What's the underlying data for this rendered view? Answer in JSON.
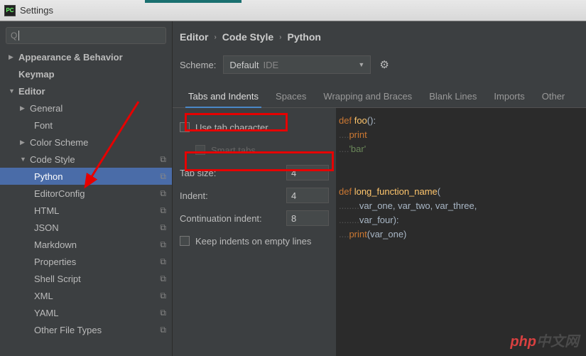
{
  "window": {
    "title": "Settings",
    "logo_text": "PC"
  },
  "search": {
    "placeholder": "Q"
  },
  "tree": {
    "appearance": "Appearance & Behavior",
    "keymap": "Keymap",
    "editor": "Editor",
    "general": "General",
    "font": "Font",
    "color_scheme": "Color Scheme",
    "code_style": "Code Style",
    "python": "Python",
    "editorconfig": "EditorConfig",
    "html": "HTML",
    "json": "JSON",
    "markdown": "Markdown",
    "properties": "Properties",
    "shell_script": "Shell Script",
    "xml": "XML",
    "yaml": "YAML",
    "other_file_types": "Other File Types"
  },
  "breadcrumb": {
    "p1": "Editor",
    "p2": "Code Style",
    "p3": "Python"
  },
  "scheme": {
    "label": "Scheme:",
    "value": "Default",
    "tag": "IDE"
  },
  "tabs": {
    "t1": "Tabs and Indents",
    "t2": "Spaces",
    "t3": "Wrapping and Braces",
    "t4": "Blank Lines",
    "t5": "Imports",
    "t6": "Other"
  },
  "form": {
    "use_tab_char": "Use tab character",
    "smart_tabs": "Smart tabs",
    "tab_size_label": "Tab size:",
    "tab_size_value": "4",
    "indent_label": "Indent:",
    "indent_value": "4",
    "cont_indent_label": "Continuation indent:",
    "cont_indent_value": "8",
    "keep_indents": "Keep indents on empty lines"
  },
  "preview": {
    "l1_kw": "def",
    "l1_fn": "foo",
    "l1_rest": "():",
    "l2_kw": "print",
    "l3_str": "'bar'",
    "l4_kw": "def",
    "l4_fn": "long_function_name",
    "l4_rest": "(",
    "l5": "var_one, var_two, var_three,",
    "l6": "var_four):",
    "l7_kw": "print",
    "l7_rest": "(var_one)"
  },
  "watermark": {
    "p1": "php",
    "p2": "中文网"
  }
}
